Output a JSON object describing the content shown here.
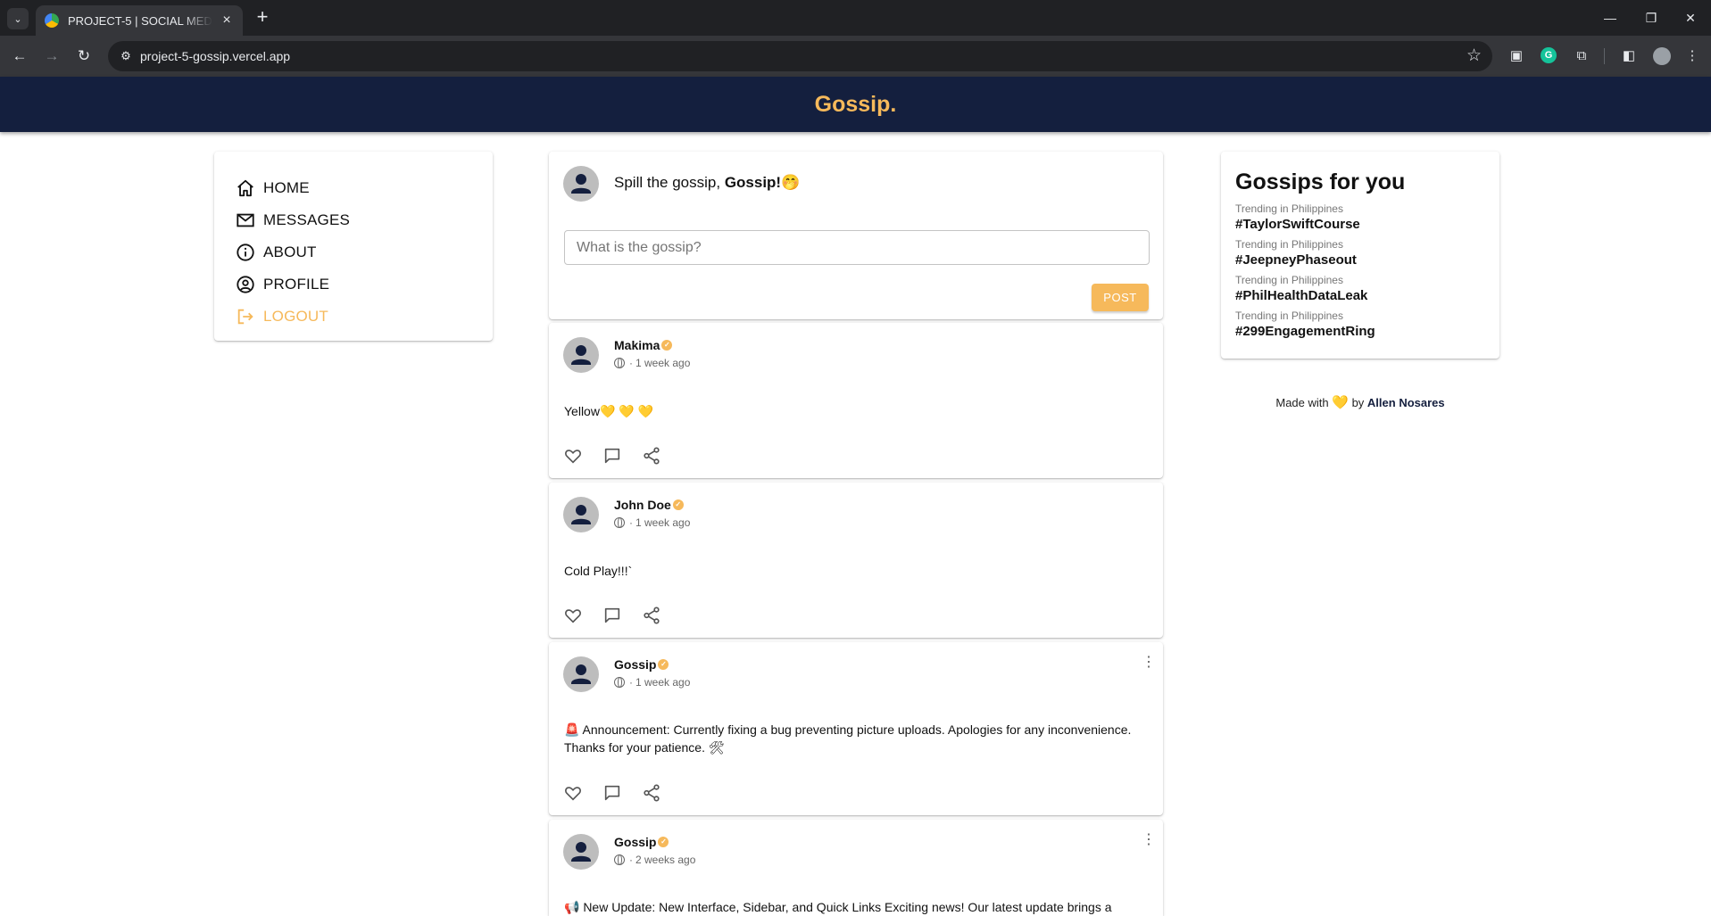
{
  "browser": {
    "tab_title": "PROJECT-5 | SOCIAL MEDIA APP",
    "url": "project-5-gossip.vercel.app",
    "tab_list_icon": "chevron-down-icon",
    "new_tab_icon": "plus-icon"
  },
  "header": {
    "title": "Gossip."
  },
  "sidebar": {
    "items": [
      {
        "label": "HOME",
        "icon": "home-icon"
      },
      {
        "label": "MESSAGES",
        "icon": "mail-icon"
      },
      {
        "label": "ABOUT",
        "icon": "info-icon"
      },
      {
        "label": "PROFILE",
        "icon": "account-circle-icon"
      },
      {
        "label": "LOGOUT",
        "icon": "logout-icon"
      }
    ]
  },
  "composer": {
    "prompt_text": "Spill the gossip,",
    "user_name": "Gossip!",
    "emoji": "🤭",
    "placeholder": "What is the gossip?",
    "post_label": "POST"
  },
  "posts": [
    {
      "author": "Makima",
      "time": "1 week ago",
      "text": "Yellow💛 💛 💛",
      "menu": false
    },
    {
      "author": "John Doe",
      "time": "1 week ago",
      "text": "Cold Play!!!`",
      "menu": false
    },
    {
      "author": "Gossip",
      "time": "1 week ago",
      "text": "🚨 Announcement: Currently fixing a bug preventing picture uploads. Apologies for any inconvenience. Thanks for your patience. 🛠",
      "menu": true
    },
    {
      "author": "Gossip",
      "time": "2 weeks ago",
      "text": "📢 New Update: New Interface, Sidebar, and Quick Links Exciting news! Our latest update brings a",
      "menu": true
    }
  ],
  "trends": {
    "title": "Gossips for you",
    "items": [
      {
        "location": "Trending in Philippines",
        "tag": "#TaylorSwiftCourse"
      },
      {
        "location": "Trending in Philippines",
        "tag": "#JeepneyPhaseout"
      },
      {
        "location": "Trending in Philippines",
        "tag": "#PhilHealthDataLeak"
      },
      {
        "location": "Trending in Philippines",
        "tag": "#299EngagementRing"
      }
    ]
  },
  "footer": {
    "prefix": "Made with",
    "heart": "💛",
    "by": "by",
    "author": "Allen Nosares"
  },
  "colors": {
    "navy": "#141f3e",
    "accent": "#f6b95b"
  }
}
